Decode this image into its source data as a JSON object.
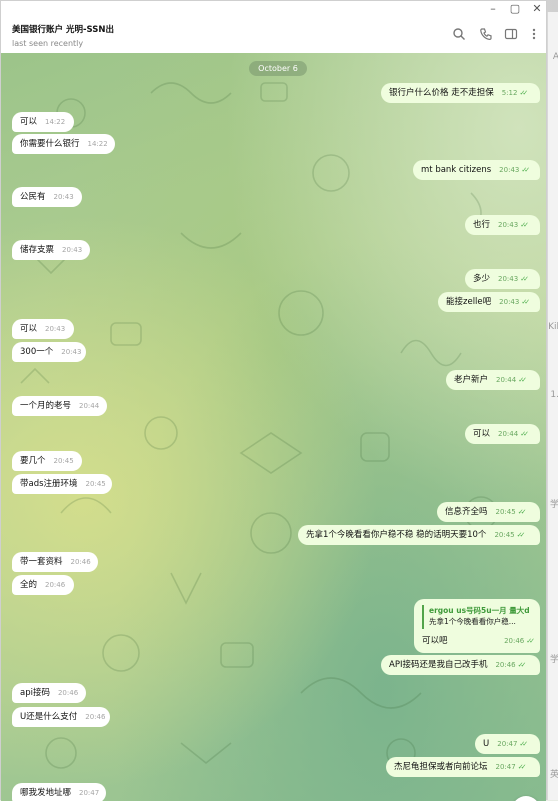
{
  "header": {
    "chat_title": "美国银行账户 光明-SSN出",
    "status": "last seen recently",
    "icons": [
      "search-icon",
      "phone-icon",
      "sidebar-toggle-icon",
      "more-icon"
    ]
  },
  "window_controls": [
    "minimize-icon",
    "maximize-icon",
    "close-icon"
  ],
  "date_separator": "October 6",
  "messages": [
    {
      "dir": "out",
      "text": "银行户什么价格 走不走担保",
      "time": "5:12"
    },
    {
      "dir": "in",
      "text": "可以",
      "time": "14:22"
    },
    {
      "dir": "in",
      "text": "你需要什么银行",
      "time": "14:22"
    },
    {
      "dir": "out",
      "text": "mt bank   citizens",
      "time": "20:43"
    },
    {
      "dir": "in",
      "text": "公民有",
      "time": "20:43"
    },
    {
      "dir": "out",
      "text": "也行",
      "time": "20:43"
    },
    {
      "dir": "in",
      "text": "储存支票",
      "time": "20:43"
    },
    {
      "dir": "out",
      "text": "多少",
      "time": "20:43"
    },
    {
      "dir": "out",
      "text": "能接zelle吧",
      "time": "20:43"
    },
    {
      "dir": "in",
      "text": "可以",
      "time": "20:43"
    },
    {
      "dir": "in",
      "text": "300一个",
      "time": "20:43"
    },
    {
      "dir": "out",
      "text": "老户新户",
      "time": "20:44"
    },
    {
      "dir": "in",
      "text": "一个月的老号",
      "time": "20:44"
    },
    {
      "dir": "out",
      "text": "可以",
      "time": "20:44"
    },
    {
      "dir": "in",
      "text": "要几个",
      "time": "20:45"
    },
    {
      "dir": "in",
      "text": "带ads注册环境",
      "time": "20:45"
    },
    {
      "dir": "out",
      "text": "信息齐全吗",
      "time": "20:45"
    },
    {
      "dir": "out",
      "text": "先拿1个今晚看看你户稳不稳 稳的话明天要10个",
      "time": "20:45"
    },
    {
      "dir": "in",
      "text": "带一套资料",
      "time": "20:46"
    },
    {
      "dir": "in",
      "text": "全的",
      "time": "20:46"
    },
    {
      "dir": "out",
      "text": "API接码还是我自己改手机",
      "time": "20:46"
    },
    {
      "dir": "in",
      "text": "api接码",
      "time": "20:46"
    },
    {
      "dir": "in",
      "text": "U还是什么支付",
      "time": "20:46"
    },
    {
      "dir": "out",
      "text": "U",
      "time": "20:47"
    },
    {
      "dir": "out",
      "text": "杰尼龟担保或者向前论坛",
      "time": "20:47"
    },
    {
      "dir": "in",
      "text": "哪我发地址哪",
      "time": "20:47"
    }
  ],
  "reply_message": {
    "quoted_name": "ergou us号码5u一月 量大d",
    "quoted_text": "先拿1个今晚看看你户稳...",
    "text": "可以吧",
    "time": "20:46"
  },
  "right_strip_labels": [
    "A",
    "Kil",
    "1.",
    "学",
    "学",
    "英"
  ],
  "colors": {
    "incoming": "#ffffff",
    "outgoing": "#effdde",
    "ticks": "#4fae4e",
    "date_pill": "#7e9a6e"
  }
}
